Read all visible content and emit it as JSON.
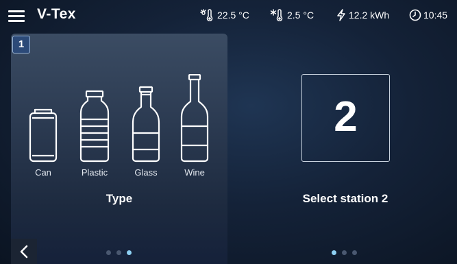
{
  "header": {
    "title": "V-Tex",
    "ambient_temp": "22.5 °C",
    "fridge_temp": "2.5 °C",
    "energy": "12.2 kWh",
    "time": "10:45"
  },
  "left_panel": {
    "station_number": "1",
    "title": "Type",
    "types": [
      {
        "label": "Can",
        "icon": "can-icon"
      },
      {
        "label": "Plastic",
        "icon": "plastic-bottle-icon"
      },
      {
        "label": "Glass",
        "icon": "glass-bottle-icon"
      },
      {
        "label": "Wine",
        "icon": "wine-bottle-icon"
      }
    ],
    "page_count": 3,
    "active_page": 3
  },
  "right_panel": {
    "station_number": "2",
    "label": "Select station 2",
    "page_count": 3,
    "active_page": 1
  },
  "colors": {
    "accent": "#8ed0f2",
    "badge_bg": "#2c4a78",
    "background": "#142238"
  }
}
